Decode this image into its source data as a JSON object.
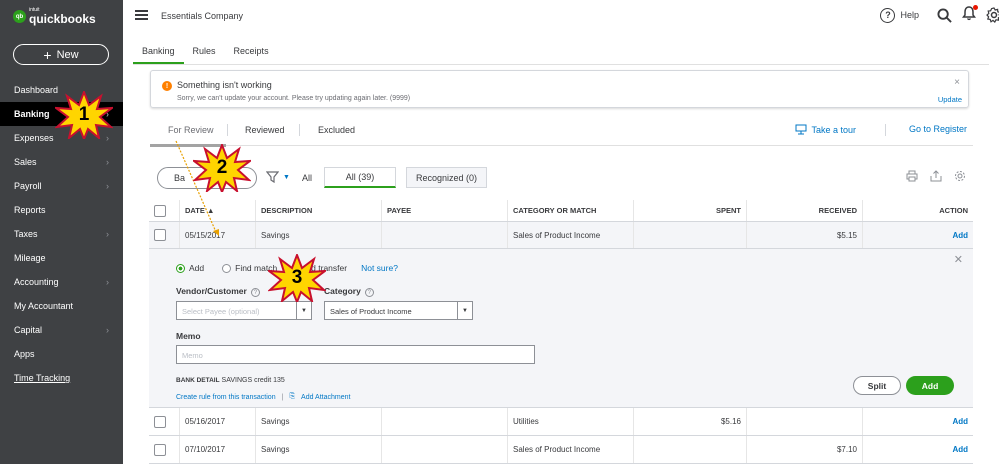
{
  "sidebar": {
    "logo_small": "intuit",
    "logo_name": "quickbooks",
    "new_button": "New",
    "items": [
      {
        "label": "Dashboard",
        "chevron": false
      },
      {
        "label": "Banking",
        "chevron": true
      },
      {
        "label": "Expenses",
        "chevron": true
      },
      {
        "label": "Sales",
        "chevron": true
      },
      {
        "label": "Payroll",
        "chevron": true
      },
      {
        "label": "Reports",
        "chevron": false
      },
      {
        "label": "Taxes",
        "chevron": true
      },
      {
        "label": "Mileage",
        "chevron": false
      },
      {
        "label": "Accounting",
        "chevron": true
      },
      {
        "label": "My Accountant",
        "chevron": false
      },
      {
        "label": "Capital",
        "chevron": true
      },
      {
        "label": "Apps",
        "chevron": false
      },
      {
        "label": "Time Tracking",
        "chevron": false
      }
    ]
  },
  "header": {
    "company": "Essentials Company",
    "help": "Help"
  },
  "tabs": [
    "Banking",
    "Rules",
    "Receipts"
  ],
  "alert": {
    "title": "Something isn't working",
    "message": "Sorry, we can't update your account. Please try updating again later. (9999)",
    "update": "Update",
    "close": "×"
  },
  "subtabs": [
    "For Review",
    "Reviewed",
    "Excluded"
  ],
  "tour": "Take a tour",
  "goto_register": "Go to Register",
  "toolbar": {
    "batch": "Ba",
    "all": "All",
    "all_count": "All (39)",
    "recognized": "Recognized (0)"
  },
  "table": {
    "headers": [
      "DATE ▲",
      "DESCRIPTION",
      "PAYEE",
      "CATEGORY OR MATCH",
      "SPENT",
      "RECEIVED",
      "ACTION"
    ],
    "first_row": {
      "date": "05/15/2017",
      "description": "Savings",
      "payee": "",
      "category": "Sales of Product Income",
      "spent": "",
      "received": "$5.15",
      "action": "Add"
    },
    "rows": [
      {
        "date": "05/16/2017",
        "description": "Savings",
        "payee": "",
        "category": "Utilities",
        "spent": "$5.16",
        "received": "",
        "action": "Add"
      },
      {
        "date": "07/10/2017",
        "description": "Savings",
        "payee": "",
        "category": "Sales of Product Income",
        "spent": "",
        "received": "$7.10",
        "action": "Add"
      }
    ]
  },
  "expanded": {
    "radio_add": "Add",
    "radio_find": "Find match",
    "radio_transfer": "d transfer",
    "not_sure": "Not sure?",
    "vendor_label": "Vendor/Customer",
    "vendor_placeholder": "Select Payee (optional)",
    "category_label": "Category",
    "category_value": "Sales of Product Income",
    "memo_label": "Memo",
    "memo_placeholder": "Memo",
    "bank_detail_label": "BANK DETAIL",
    "bank_detail_value": "SAVINGS credit 135",
    "create_rule": "Create rule from this transaction",
    "add_attachment": "Add Attachment",
    "split": "Split",
    "add": "Add"
  },
  "callouts": [
    "1",
    "2",
    "3"
  ],
  "colors": {
    "accent": "#2ca01c",
    "link": "#0077c5",
    "sidebar": "#3f4144",
    "star": "#ffd500",
    "star_outline": "#c8102e"
  }
}
